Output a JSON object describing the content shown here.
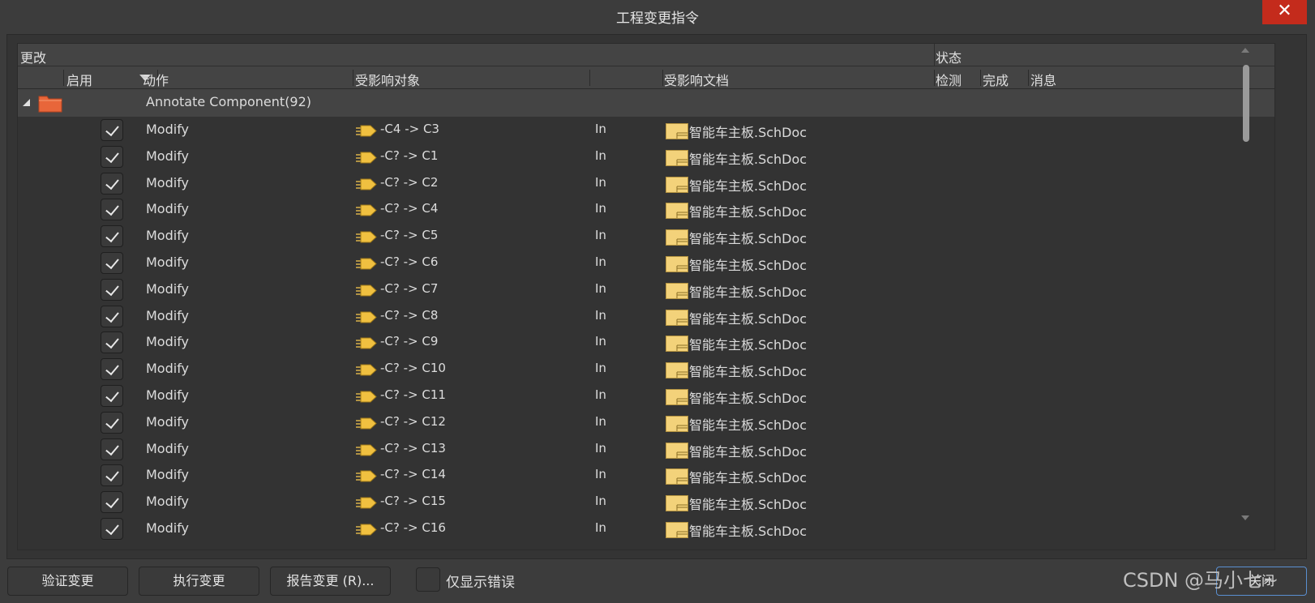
{
  "window": {
    "title": "工程变更指令",
    "close_glyph": "✕"
  },
  "table": {
    "group_headers": {
      "changes": "更改",
      "status": "状态"
    },
    "columns": {
      "enable": "启用",
      "action": "动作",
      "affected_object": "受影响对象",
      "affected_document": "受影响文档",
      "check": "检测",
      "done": "完成",
      "message": "消息"
    },
    "group": {
      "label": "Annotate Component(92)",
      "icon": "folder-icon"
    },
    "rows": [
      {
        "action": "Modify",
        "object": "-C4 -> C3",
        "in": "In",
        "document": "智能车主板.SchDoc",
        "enabled": true
      },
      {
        "action": "Modify",
        "object": "-C? -> C1",
        "in": "In",
        "document": "智能车主板.SchDoc",
        "enabled": true
      },
      {
        "action": "Modify",
        "object": "-C? -> C2",
        "in": "In",
        "document": "智能车主板.SchDoc",
        "enabled": true
      },
      {
        "action": "Modify",
        "object": "-C? -> C4",
        "in": "In",
        "document": "智能车主板.SchDoc",
        "enabled": true
      },
      {
        "action": "Modify",
        "object": "-C? -> C5",
        "in": "In",
        "document": "智能车主板.SchDoc",
        "enabled": true
      },
      {
        "action": "Modify",
        "object": "-C? -> C6",
        "in": "In",
        "document": "智能车主板.SchDoc",
        "enabled": true
      },
      {
        "action": "Modify",
        "object": "-C? -> C7",
        "in": "In",
        "document": "智能车主板.SchDoc",
        "enabled": true
      },
      {
        "action": "Modify",
        "object": "-C? -> C8",
        "in": "In",
        "document": "智能车主板.SchDoc",
        "enabled": true
      },
      {
        "action": "Modify",
        "object": "-C? -> C9",
        "in": "In",
        "document": "智能车主板.SchDoc",
        "enabled": true
      },
      {
        "action": "Modify",
        "object": "-C? -> C10",
        "in": "In",
        "document": "智能车主板.SchDoc",
        "enabled": true
      },
      {
        "action": "Modify",
        "object": "-C? -> C11",
        "in": "In",
        "document": "智能车主板.SchDoc",
        "enabled": true
      },
      {
        "action": "Modify",
        "object": "-C? -> C12",
        "in": "In",
        "document": "智能车主板.SchDoc",
        "enabled": true
      },
      {
        "action": "Modify",
        "object": "-C? -> C13",
        "in": "In",
        "document": "智能车主板.SchDoc",
        "enabled": true
      },
      {
        "action": "Modify",
        "object": "-C? -> C14",
        "in": "In",
        "document": "智能车主板.SchDoc",
        "enabled": true
      },
      {
        "action": "Modify",
        "object": "-C? -> C15",
        "in": "In",
        "document": "智能车主板.SchDoc",
        "enabled": true
      },
      {
        "action": "Modify",
        "object": "-C? -> C16",
        "in": "In",
        "document": "智能车主板.SchDoc",
        "enabled": true
      }
    ]
  },
  "footer": {
    "validate_label": "验证变更",
    "execute_label": "执行变更",
    "report_label": "报告变更 (R)...",
    "only_errors_label": "仅显示错误",
    "close_label": "关闭",
    "watermark": "CSDN @马小七~"
  },
  "colors": {
    "background": "#3c3c3c",
    "close_red": "#c42b1c",
    "folder_orange": "#e8663a",
    "doc_yellow": "#f3d27a",
    "focus_blue": "#5a8fd0"
  }
}
